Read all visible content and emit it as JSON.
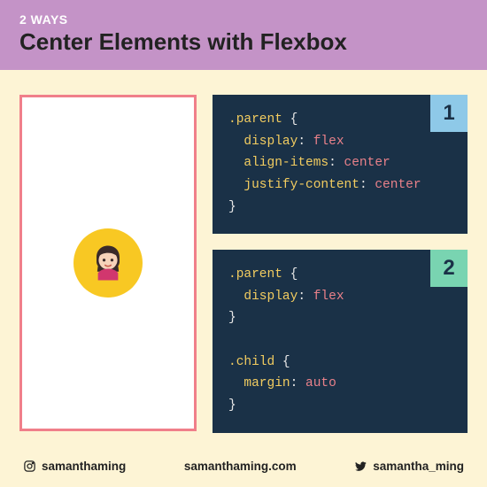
{
  "header": {
    "eyebrow": "2 WAYS",
    "title": "Center Elements with Flexbox"
  },
  "cards": {
    "one": {
      "number": "1",
      "selector": ".parent",
      "props": [
        {
          "name": "display",
          "value": "flex"
        },
        {
          "name": "align-items",
          "value": "center"
        },
        {
          "name": "justify-content",
          "value": "center"
        }
      ]
    },
    "two": {
      "number": "2",
      "blocks": [
        {
          "selector": ".parent",
          "props": [
            {
              "name": "display",
              "value": "flex"
            }
          ]
        },
        {
          "selector": ".child",
          "props": [
            {
              "name": "margin",
              "value": "auto"
            }
          ]
        }
      ]
    }
  },
  "footer": {
    "instagram": "samanthaming",
    "site": "samanthaming.com",
    "twitter": "samantha_ming"
  }
}
